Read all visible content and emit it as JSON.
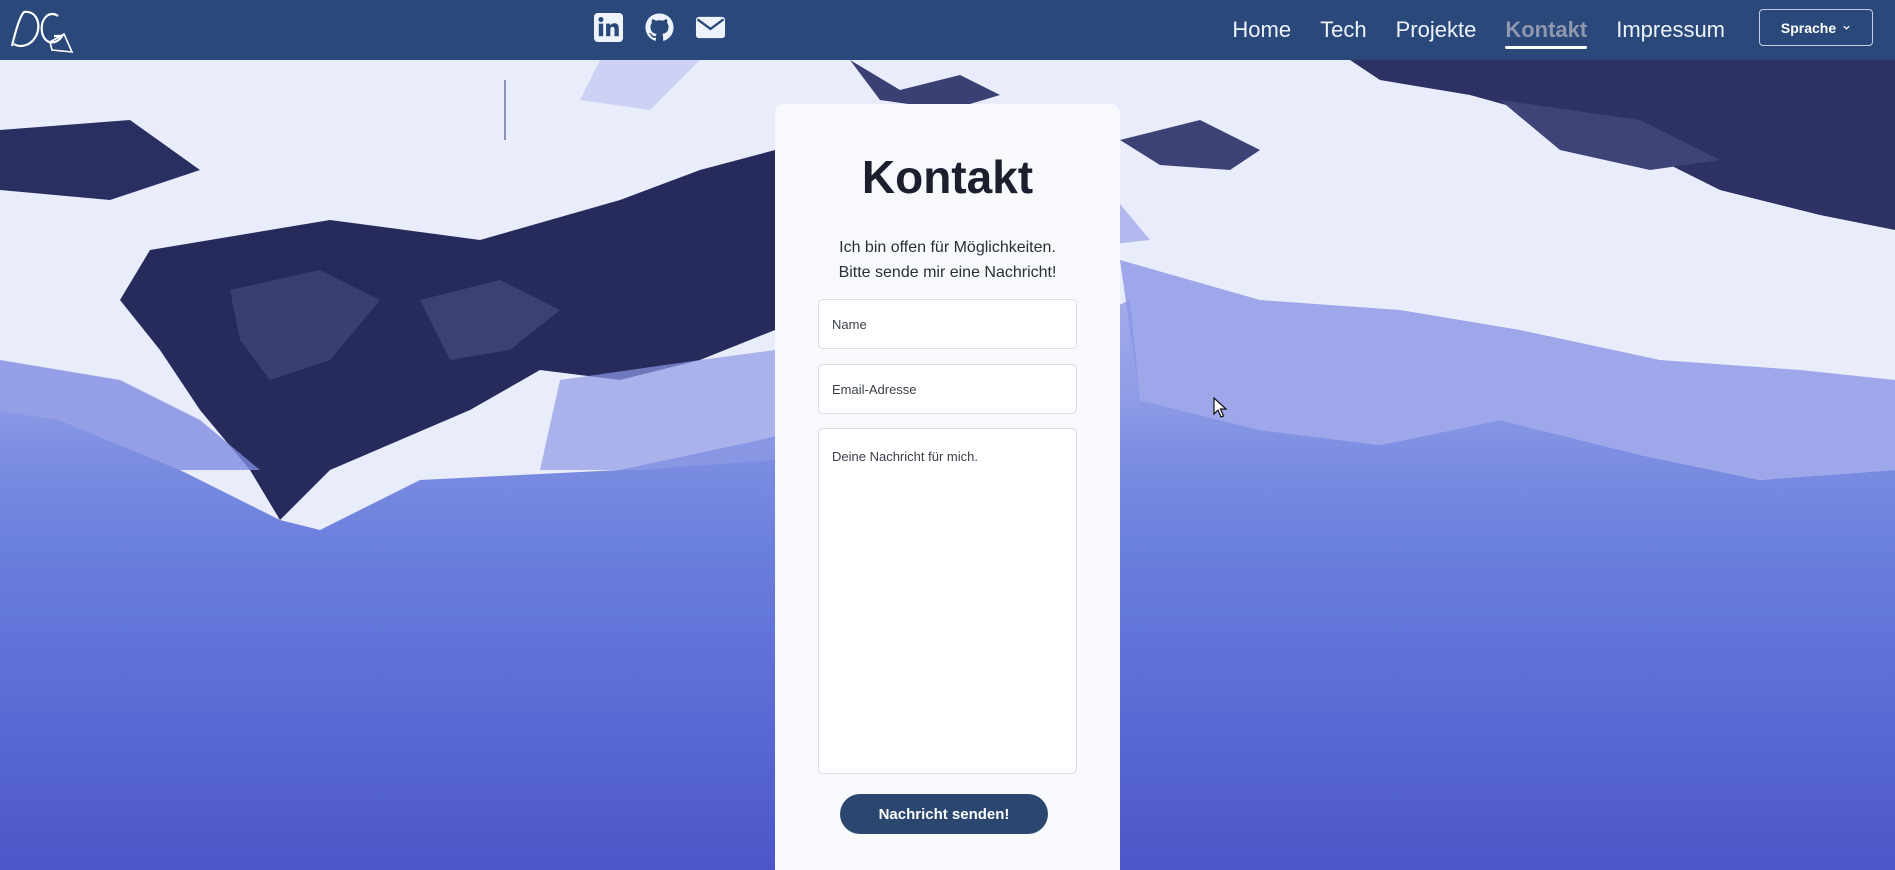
{
  "nav": {
    "logo_text": "DG",
    "social": [
      {
        "icon": "linkedin-icon"
      },
      {
        "icon": "github-icon"
      },
      {
        "icon": "mail-icon"
      }
    ],
    "links": [
      {
        "label": "Home",
        "active": false
      },
      {
        "label": "Tech",
        "active": false
      },
      {
        "label": "Projekte",
        "active": false
      },
      {
        "label": "Kontakt",
        "active": true
      },
      {
        "label": "Impressum",
        "active": false
      }
    ],
    "language_button": "Sprache"
  },
  "contact": {
    "title": "Kontakt",
    "intro_line1": "Ich bin offen für Möglichkeiten.",
    "intro_line2": "Bitte sende mir eine Nachricht!",
    "name_placeholder": "Name",
    "email_placeholder": "Email-Adresse",
    "message_placeholder": "Deine Nachricht für mich.",
    "submit_label": "Nachricht senden!"
  },
  "colors": {
    "navbar": "#2a4879",
    "active_link": "#8e97ad",
    "button": "#2c476f",
    "card": "#f8f9fd"
  }
}
